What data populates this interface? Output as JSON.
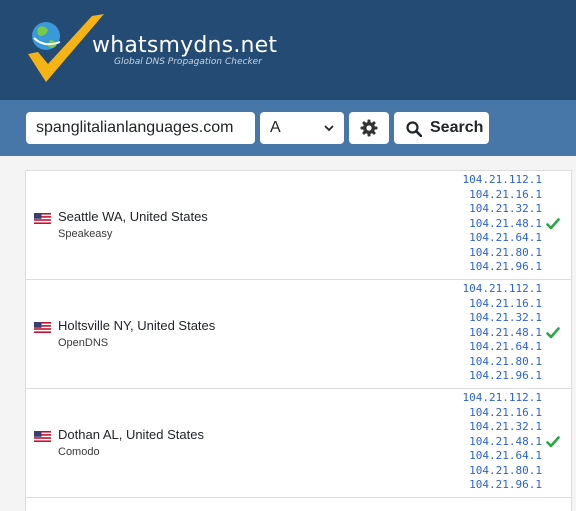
{
  "header": {
    "brand": "whatsmydns.net",
    "tagline": "Global DNS Propagation Checker",
    "colors": {
      "bg": "#234b73",
      "logo_check": "#f5b414",
      "logo_globe": "#3a9ad9"
    }
  },
  "toolbar": {
    "domain_value": "spanglitalianlanguages.com",
    "record_type": "A",
    "search_label": "Search",
    "icons": {
      "settings": "gear-icon",
      "search": "search-icon"
    }
  },
  "results": [
    {
      "location": "Seattle WA, United States",
      "provider": "Speakeasy",
      "flag": "us-flag-icon",
      "status": "check-icon",
      "ips": [
        "104.21.112.1",
        "104.21.16.1",
        "104.21.32.1",
        "104.21.48.1",
        "104.21.64.1",
        "104.21.80.1",
        "104.21.96.1"
      ]
    },
    {
      "location": "Holtsville NY, United States",
      "provider": "OpenDNS",
      "flag": "us-flag-icon",
      "status": "check-icon",
      "ips": [
        "104.21.112.1",
        "104.21.16.1",
        "104.21.32.1",
        "104.21.48.1",
        "104.21.64.1",
        "104.21.80.1",
        "104.21.96.1"
      ]
    },
    {
      "location": "Dothan AL, United States",
      "provider": "Comodo",
      "flag": "us-flag-icon",
      "status": "check-icon",
      "ips": [
        "104.21.112.1",
        "104.21.16.1",
        "104.21.32.1",
        "104.21.48.1",
        "104.21.64.1",
        "104.21.80.1",
        "104.21.96.1"
      ]
    }
  ]
}
